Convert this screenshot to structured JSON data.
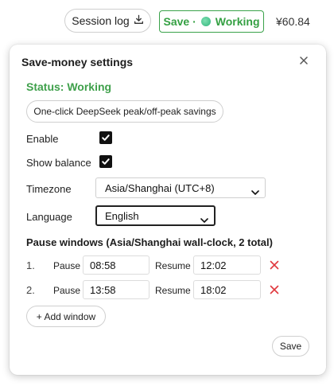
{
  "topbar": {
    "session_log_label": "Session log",
    "save_label": "Save ·",
    "working_label": "Working",
    "balance": "¥60.84"
  },
  "panel": {
    "title": "Save-money settings",
    "status": "Status: Working",
    "oneclick_label": "One-click DeepSeek peak/off-peak savings",
    "enable_label": "Enable",
    "enable_checked": true,
    "show_balance_label": "Show balance",
    "show_balance_checked": true,
    "timezone_label": "Timezone",
    "timezone_value": "Asia/Shanghai (UTC+8)",
    "language_label": "Language",
    "language_value": "English",
    "pause_title": "Pause windows (Asia/Shanghai wall-clock, 2 total)",
    "windows": [
      {
        "num": "1.",
        "pause_label": "Pause",
        "pause": "08:58",
        "resume_label": "Resume",
        "resume": "12:02"
      },
      {
        "num": "2.",
        "pause_label": "Pause",
        "pause": "13:58",
        "resume_label": "Resume",
        "resume": "18:02"
      }
    ],
    "add_window_label": "+ Add window",
    "save_label": "Save"
  },
  "colors": {
    "accent_green": "#3aa24a",
    "delete_red": "#e0383e"
  }
}
